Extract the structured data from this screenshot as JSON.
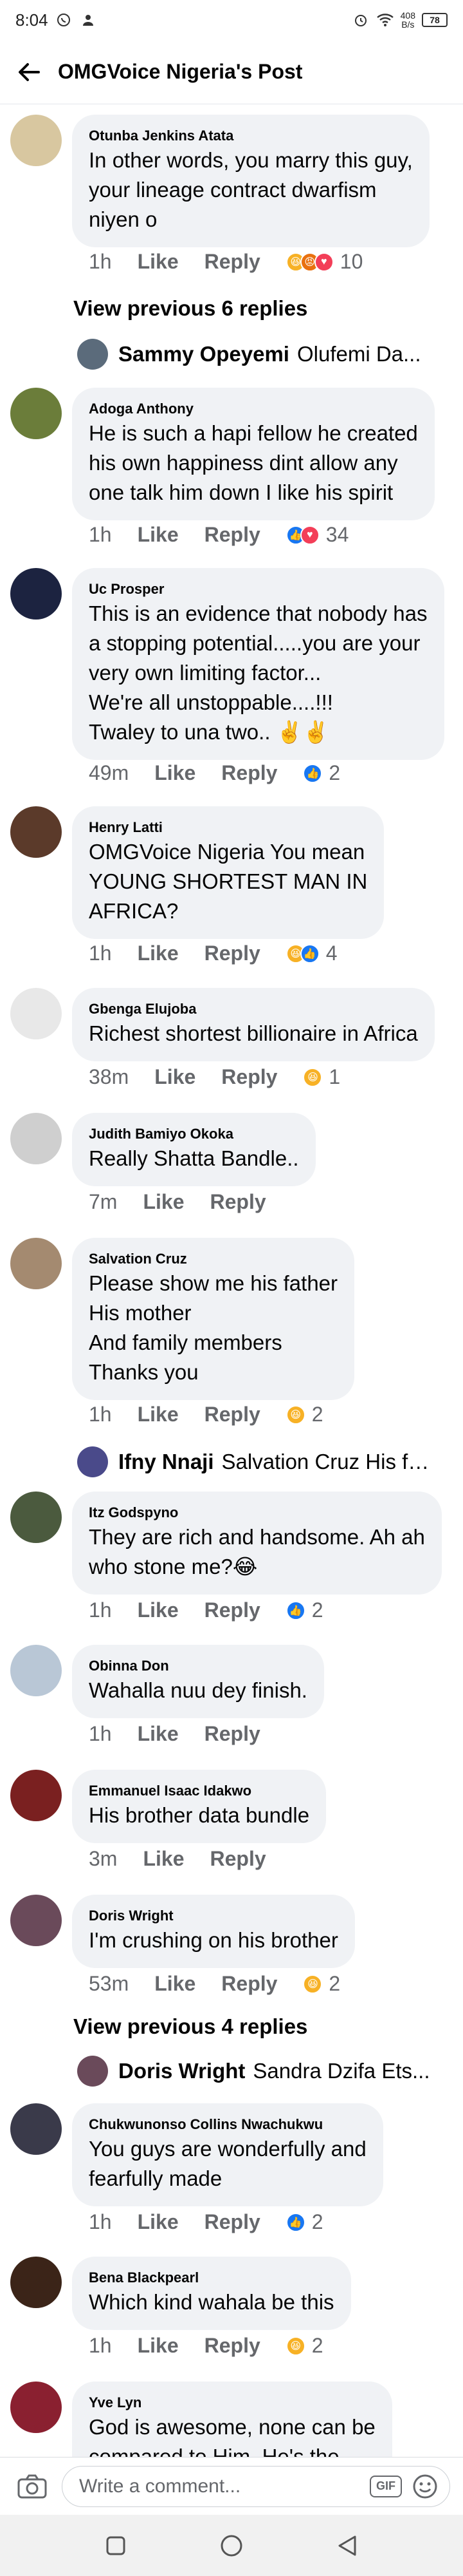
{
  "status": {
    "time": "8:04",
    "speed_value": "408",
    "speed_unit": "B/s",
    "battery": "78"
  },
  "header": {
    "title": "OMGVoice Nigeria's Post"
  },
  "comments": [
    {
      "author": "Otunba Jenkins Atata",
      "text": "In other words, you marry this guy,\nyour lineage contract dwarfism\nniyen o",
      "time": "1h",
      "like": "Like",
      "reply": "Reply",
      "reactions": [
        "haha",
        "angry",
        "love"
      ],
      "count": "10",
      "avatar_color": "#d8c7a0"
    },
    {
      "author": "Adoga Anthony",
      "text": "He is such a hapi fellow he created\nhis own happiness dint allow any\none talk him down I like his spirit",
      "time": "1h",
      "like": "Like",
      "reply": "Reply",
      "reactions": [
        "like",
        "love"
      ],
      "count": "34",
      "avatar_color": "#6b7d3a"
    },
    {
      "author": "Uc Prosper",
      "text": "This is an evidence that nobody has\na stopping potential.....you are your\nvery own limiting factor...\nWe're all unstoppable....!!!\nTwaley to una two.. ✌️✌️",
      "time": "49m",
      "like": "Like",
      "reply": "Reply",
      "reactions": [
        "like"
      ],
      "count": "2",
      "avatar_color": "#1c2340"
    },
    {
      "author": "Henry Latti",
      "text": "OMGVoice Nigeria You mean\nYOUNG SHORTEST MAN IN\nAFRICA?",
      "time": "1h",
      "like": "Like",
      "reply": "Reply",
      "reactions": [
        "haha",
        "like"
      ],
      "count": "4",
      "avatar_color": "#5b3a2a"
    },
    {
      "author": "Gbenga Elujoba",
      "text": "Richest shortest billionaire in Africa",
      "time": "38m",
      "like": "Like",
      "reply": "Reply",
      "reactions": [
        "haha"
      ],
      "count": "1",
      "avatar_color": "#e8e8e8"
    },
    {
      "author": "Judith Bamiyo Okoka",
      "text": "Really Shatta Bandle..",
      "time": "7m",
      "like": "Like",
      "reply": "Reply",
      "reactions": [],
      "count": "",
      "avatar_color": "#cfcfcf"
    },
    {
      "author": "Salvation Cruz",
      "text": "Please show me his father\nHis mother\nAnd family members\nThanks you",
      "time": "1h",
      "like": "Like",
      "reply": "Reply",
      "reactions": [
        "haha"
      ],
      "count": "2",
      "avatar_color": "#a48a70"
    },
    {
      "author": "Itz Godspyno",
      "text": "They are rich and handsome. Ah ah\nwho stone me?😂",
      "time": "1h",
      "like": "Like",
      "reply": "Reply",
      "reactions": [
        "like"
      ],
      "count": "2",
      "avatar_color": "#4b5a3e"
    },
    {
      "author": "Obinna Don",
      "text": "Wahalla nuu dey finish.",
      "time": "1h",
      "like": "Like",
      "reply": "Reply",
      "reactions": [],
      "count": "",
      "avatar_color": "#b9c7d6"
    },
    {
      "author": "Emmanuel Isaac Idakwo",
      "text": "His brother data bundle",
      "time": "3m",
      "like": "Like",
      "reply": "Reply",
      "reactions": [],
      "count": "",
      "avatar_color": "#7a2020"
    },
    {
      "author": "Doris Wright",
      "text": "I'm crushing on his brother",
      "time": "53m",
      "like": "Like",
      "reply": "Reply",
      "reactions": [
        "haha"
      ],
      "count": "2",
      "avatar_color": "#6a4a5a"
    },
    {
      "author": "Chukwunonso Collins Nwachukwu",
      "text": "You guys are wonderfully and\nfearfully made",
      "time": "1h",
      "like": "Like",
      "reply": "Reply",
      "reactions": [
        "like"
      ],
      "count": "2",
      "avatar_color": "#3a3a4a"
    },
    {
      "author": "Bena Blackpearl",
      "text": "Which kind wahala be this",
      "time": "1h",
      "like": "Like",
      "reply": "Reply",
      "reactions": [
        "haha"
      ],
      "count": "2",
      "avatar_color": "#3b2418"
    },
    {
      "author": "Yve Lyn",
      "text": "God is awesome, none can be\ncompared to Him. He's the",
      "time": "",
      "like": "",
      "reply": "",
      "reactions": [],
      "count": "",
      "avatar_color": "#8a2030"
    }
  ],
  "view_previous": [
    "View previous 6 replies",
    "View previous 4 replies"
  ],
  "reply_previews": [
    {
      "name": "Sammy Opeyemi",
      "text": "Olufemi Da...",
      "avatar_color": "#5b6b7b"
    },
    {
      "name": "Ifny Nnaji",
      "text": "Salvation Cruz His fat...",
      "avatar_color": "#4a4a8a"
    },
    {
      "name": "Doris Wright",
      "text": "Sandra Dzifa Ets...",
      "avatar_color": "#6a4a5a"
    }
  ],
  "composer": {
    "placeholder": "Write a comment...",
    "gif": "GIF"
  },
  "colors": {
    "bubble": "#f0f2f5",
    "meta": "#65676b",
    "like_blue": "#1877f2",
    "love_red": "#f33e58",
    "haha_yellow": "#f7b125"
  },
  "icons": [
    "whatsapp-icon",
    "person-icon",
    "alarm-icon",
    "back-arrow-icon",
    "camera-icon",
    "emoji-icon",
    "square-nav-icon",
    "circle-nav-icon",
    "triangle-back-nav-icon"
  ]
}
